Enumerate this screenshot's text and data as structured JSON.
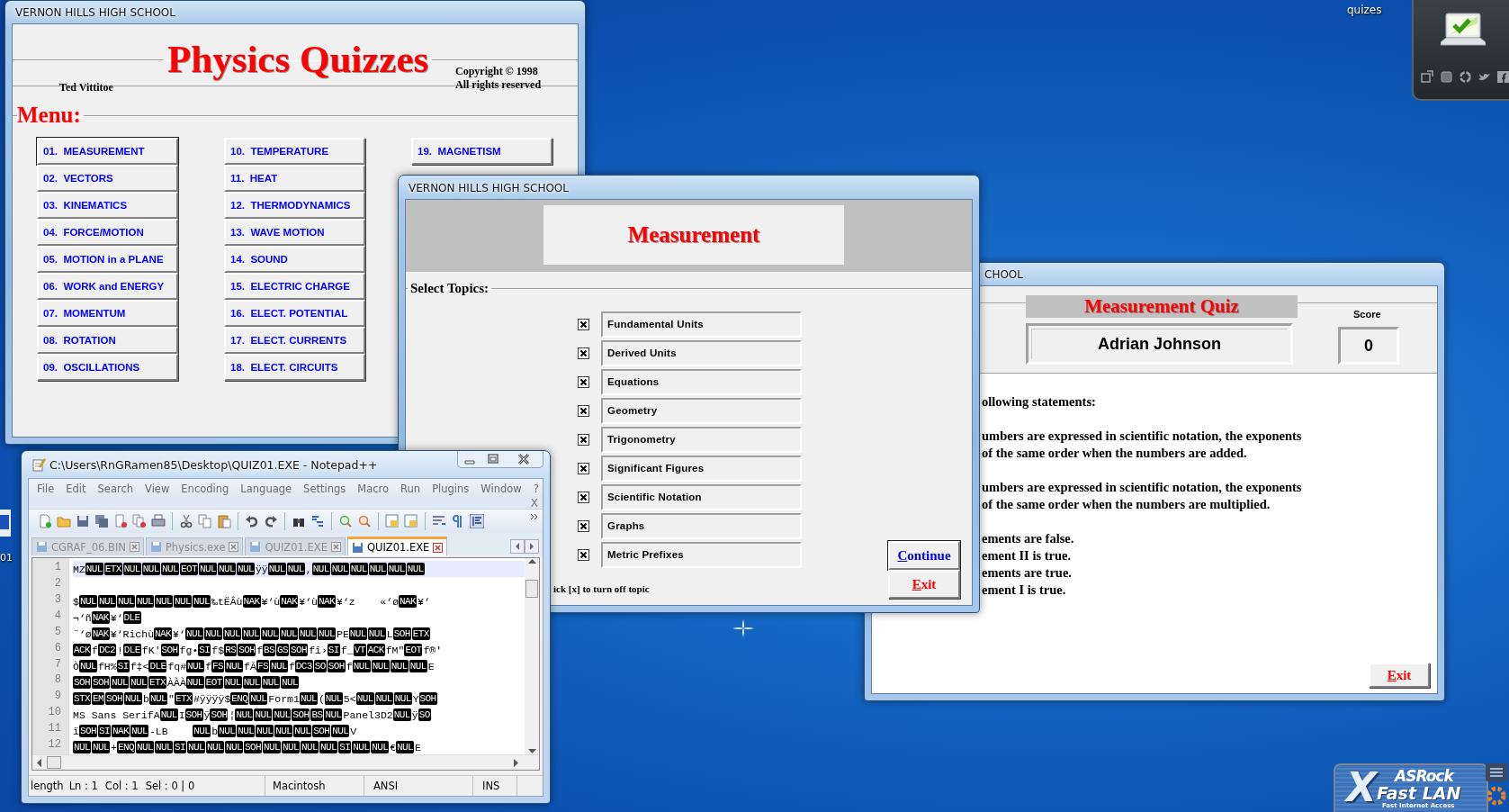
{
  "desktop": {
    "icon_label": "quizes",
    "edge_label": "01",
    "logo": {
      "brand": "ASRock",
      "mark": "X",
      "product": "Fast LAN",
      "tagline": "Fast Internet Access"
    }
  },
  "menu_window": {
    "title": "VERNON HILLS HIGH SCHOOL",
    "heading": "Physics Quizzes",
    "author": "Ted Vittitoe",
    "copyright": [
      "Copyright © 1998",
      "All rights reserved"
    ],
    "menu_label": "Menu:",
    "items": [
      {
        "label": "01.  MEASUREMENT",
        "selected": true
      },
      {
        "label": "02.  VECTORS",
        "selected": false
      },
      {
        "label": "03.  KINEMATICS",
        "selected": false
      },
      {
        "label": "04.  FORCE/MOTION",
        "selected": false
      },
      {
        "label": "05.  MOTION in a PLANE",
        "selected": false
      },
      {
        "label": "06.  WORK and ENERGY",
        "selected": false
      },
      {
        "label": "07.  MOMENTUM",
        "selected": false
      },
      {
        "label": "08.  ROTATION",
        "selected": false
      },
      {
        "label": "09.  OSCILLATIONS",
        "selected": false
      },
      {
        "label": "10.  TEMPERATURE",
        "selected": false
      },
      {
        "label": "11.  HEAT",
        "selected": false
      },
      {
        "label": "12.  THERMODYNAMICS",
        "selected": false
      },
      {
        "label": "13.  WAVE MOTION",
        "selected": false
      },
      {
        "label": "14.  SOUND",
        "selected": false
      },
      {
        "label": "15.  ELECTRIC CHARGE",
        "selected": false
      },
      {
        "label": "16.  ELECT. POTENTIAL",
        "selected": false
      },
      {
        "label": "17.  ELECT. CURRENTS",
        "selected": false
      },
      {
        "label": "18.  ELECT. CIRCUITS",
        "selected": false
      },
      {
        "label": "19.  MAGNETISM",
        "selected": false
      }
    ]
  },
  "topics_window": {
    "title": "VERNON HILLS HIGH SCHOOL",
    "heading": "Measurement",
    "section": "Select Topics:",
    "topics": [
      {
        "label": "Fundamental Units",
        "checked": true
      },
      {
        "label": "Derived Units",
        "checked": true
      },
      {
        "label": "Equations",
        "checked": true
      },
      {
        "label": "Geometry",
        "checked": true
      },
      {
        "label": "Trigonometry",
        "checked": true
      },
      {
        "label": "Significant Figures",
        "checked": true
      },
      {
        "label": "Scientific Notation",
        "checked": true
      },
      {
        "label": "Graphs",
        "checked": true
      },
      {
        "label": "Metric Prefixes",
        "checked": true
      }
    ],
    "hint": "ick [x] to turn off topic",
    "buttons": [
      {
        "label": "Continue",
        "kind": "continue"
      },
      {
        "label": "Exit",
        "kind": "exit"
      }
    ]
  },
  "quiz_window": {
    "title": "CHOOL",
    "heading": "Measurement Quiz",
    "student": "Adrian Johnson",
    "score_label": "Score",
    "score": "0",
    "paragraphs": [
      [
        "ollowing statements:"
      ],
      [
        "umbers are expressed in scientific notation, the exponents",
        "of the same order when the numbers are added."
      ],
      [
        "umbers are expressed in scientific notation, the exponents",
        "of the same order when the numbers are multiplied."
      ],
      [
        "ements are false.",
        "ement II is true.",
        "ements are true.",
        "ement I is true."
      ]
    ],
    "exit": "Exit"
  },
  "notepad": {
    "title": "C:\\Users\\RnGRamen85\\Desktop\\QUIZ01.EXE - Notepad++",
    "menu": [
      "File",
      "Edit",
      "Search",
      "View",
      "Encoding",
      "Language",
      "Settings",
      "Macro",
      "Run",
      "Plugins",
      "Window",
      "?"
    ],
    "close_doc": "X",
    "tabs": [
      {
        "label": "CGRAF_06.BIN",
        "selected": false
      },
      {
        "label": "Physics.exe",
        "selected": false
      },
      {
        "label": "QUIZ01.EXE",
        "selected": false
      },
      {
        "label": "QUIZ01.EXE",
        "selected": true
      }
    ],
    "lines": [
      {
        "number": "1",
        "segments": [
          "MZ",
          [
            "NUL",
            "ETX",
            "NUL",
            "NUL",
            "NUL",
            "EOT",
            "NUL",
            "NUL",
            "NUL"
          ],
          "ÿÿ",
          [
            "NUL",
            "NUL"
          ],
          ",",
          [
            "NUL",
            "NUL",
            "NUL",
            "NUL",
            "NUL",
            "NUL"
          ]
        ]
      },
      {
        "number": "2"
      },
      {
        "number": "3",
        "segments": [
          "$",
          [
            "NUL",
            "NUL",
            "NUL",
            "NUL",
            "NUL",
            "NUL",
            "NUL"
          ],
          "‰tËÂù",
          [
            "NAK"
          ],
          "¥‘ù",
          [
            "NAK"
          ],
          "¥‘ù",
          [
            "NAK"
          ],
          "¥‘z    «‘ø",
          [
            "NAK"
          ],
          "¥‘"
        ]
      },
      {
        "number": "4",
        "segments": [
          "¬‘ñ",
          [
            "NAK"
          ],
          "¥‘",
          [
            "DLE"
          ]
        ]
      },
      {
        "number": "5",
        "segments": [
          "¨‘ø",
          [
            "NAK"
          ],
          "¥‘Richù",
          [
            "NAK"
          ],
          "¥‘",
          [
            "NUL",
            "NUL",
            "NUL",
            "NUL",
            "NUL",
            "NUL",
            "NUL",
            "NUL"
          ],
          "PE",
          [
            "NUL",
            "NUL"
          ],
          "L",
          [
            "SOH",
            "ETX"
          ]
        ]
      },
      {
        "number": "6",
        "segments": [
          [
            "ACK"
          ],
          "f",
          [
            "DC2"
          ],
          "!",
          [
            "DLE"
          ],
          "fK'",
          [
            "SOH"
          ],
          "fg•",
          [
            "SI"
          ],
          "f$",
          [
            "RS",
            "SOH"
          ],
          "f",
          [
            "BS",
            "GS",
            "SOH"
          ],
          "fî›",
          [
            "SI"
          ],
          "f_",
          [
            "VT",
            "ACK"
          ],
          "fM\"",
          [
            "EOT"
          ],
          "f®'"
        ]
      },
      {
        "number": "7",
        "segments": [
          "Ò",
          [
            "NUL"
          ],
          "fH%",
          [
            "SI"
          ],
          "f‡<",
          [
            "DLE"
          ],
          "fq#",
          [
            "NUL"
          ],
          "f",
          [
            "FS",
            "NUL"
          ],
          "fÃ",
          [
            "FS",
            "NUL"
          ],
          "f",
          [
            "DC3",
            "SO",
            "SOH"
          ],
          "f",
          [
            "NUL",
            "NUL",
            "NUL",
            "NUL"
          ],
          "E"
        ]
      },
      {
        "number": "8",
        "segments": [
          [
            "SOH",
            "SOH",
            "NUL"
          ],
          [
            "NUL",
            "ETX"
          ],
          "ÀÀÀ",
          [
            "NUL",
            "EOT",
            "NUL",
            "NUL",
            "NUL",
            "NUL"
          ]
        ]
      },
      {
        "number": "9",
        "segments": [
          [
            "STX",
            "EM",
            "SOH",
            "NUL"
          ],
          "b",
          [
            "NUL"
          ],
          "\"",
          [
            "ETX"
          ],
          "#ÿÿÿÿ$",
          [
            "ENQ",
            "NUL"
          ],
          "Form1",
          [
            "NUL"
          ],
          "(",
          [
            "NUL"
          ],
          "5<",
          [
            "NUL",
            "NUL",
            "NUL"
          ],
          "Y",
          [
            "SOH"
          ]
        ]
      },
      {
        "number": "10",
        "segments": [
          "MS Sans SerifA",
          [
            "NUL"
          ],
          "I",
          [
            "SOH"
          ],
          "ÿ",
          [
            "SOH"
          ],
          "¦",
          [
            "NUL",
            "NUL",
            "NUL",
            "SOH",
            "BS",
            "NUL"
          ],
          "Panel3D2",
          [
            "NUL"
          ],
          "ÿ",
          [
            "SO"
          ]
        ]
      },
      {
        "number": "11",
        "segments": [
          "ï",
          [
            "SOH",
            "SI",
            "NAK",
            "NUL"
          ],
          "-LB    ",
          [
            "NUL"
          ],
          "b",
          [
            "NUL",
            "NUL",
            "NUL",
            "NUL",
            "NUL",
            "SOH",
            "NUL"
          ],
          "V"
        ]
      },
      {
        "number": "12",
        "segments": [
          [
            "NUL",
            "NUL"
          ],
          "+",
          [
            "ENQ",
            "NUL",
            "NUL",
            "SI",
            "NUL",
            "NUL",
            "NUL",
            "SOH"
          ],
          [
            "NUL",
            "NUL",
            "NUL",
            "NUL",
            "SI",
            "NUL",
            "NUL"
          ],
          "€",
          [
            "NUL"
          ],
          "E"
        ]
      }
    ],
    "status": [
      {
        "text": "length",
        "kind": "cut"
      },
      {
        "text": "Ln : 1",
        "kind": "plain"
      },
      {
        "text": "Col : 1",
        "kind": "plain"
      },
      {
        "text": "Sel : 0 | 0",
        "kind": "plain"
      },
      {
        "text": "Macintosh",
        "kind": "cell"
      },
      {
        "text": "ANSI",
        "kind": "cell"
      },
      {
        "text": "INS",
        "kind": "cell"
      }
    ]
  }
}
